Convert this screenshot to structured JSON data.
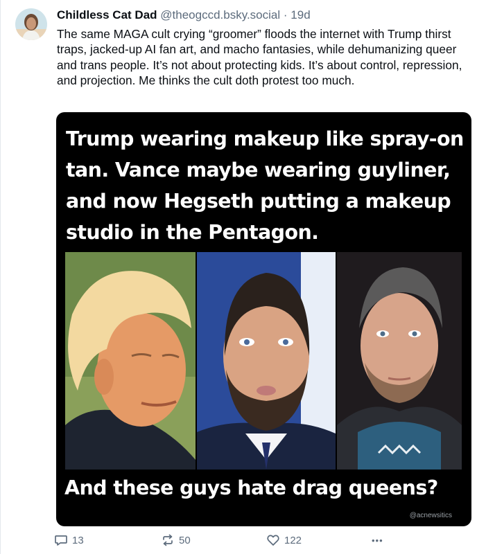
{
  "post": {
    "author_name": "Childless Cat Dad",
    "author_handle": "@theogccd.bsky.social",
    "separator": "·",
    "time": "19d",
    "text": "The same MAGA cult crying “groomer” floods the internet with Trump thirst traps, jacked-up AI fan art, and macho fantasies, while dehumanizing queer and trans people. It’s not about protecting kids. It’s about control, repression, and projection. Me thinks the cult doth protest too much."
  },
  "meme": {
    "top_text": "Trump wearing makeup like spray-on tan. Vance maybe wearing guyliner, and now Hegseth putting a makeup studio in the Pentagon.",
    "bottom_text": "And these guys hate drag queens?",
    "credit": "@acnewsitics"
  },
  "actions": {
    "reply_count": "13",
    "repost_count": "50",
    "like_count": "122",
    "more_label": "•••"
  },
  "icons": {
    "reply": "reply-icon",
    "repost": "repost-icon",
    "like": "heart-icon",
    "more": "more-icon"
  },
  "colors": {
    "muted_text": "#5c6b7c",
    "meme_background": "#000000"
  }
}
